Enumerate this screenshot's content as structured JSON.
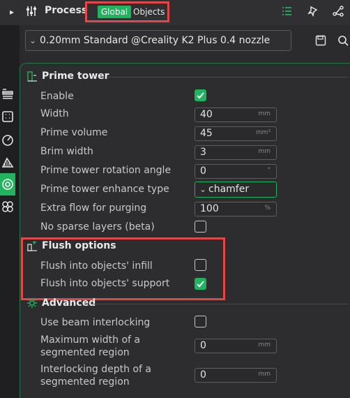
{
  "header": {
    "title": "Process",
    "tab_global": "Global",
    "tab_objects": "Objects",
    "icons": [
      "sliders-icon",
      "global-list-icon",
      "pin-icon",
      "share-icon"
    ]
  },
  "preset": {
    "name": "0.20mm Standard @Creality K2 Plus 0.4 nozzle"
  },
  "prime_tower": {
    "title": "Prime tower",
    "enable_label": "Enable",
    "enable_checked": true,
    "width_label": "Width",
    "width_value": "40",
    "width_unit": "mm",
    "volume_label": "Prime volume",
    "volume_value": "45",
    "volume_unit": "mm³",
    "brim_label": "Brim width",
    "brim_value": "3",
    "brim_unit": "mm",
    "rotation_label": "Prime tower rotation angle",
    "rotation_value": "0",
    "rotation_unit": "°",
    "enhance_label": "Prime tower enhance type",
    "enhance_value": "chamfer",
    "extra_flow_label": "Extra flow for purging",
    "extra_flow_value": "100",
    "extra_flow_unit": "%",
    "sparse_label": "No sparse layers (beta)",
    "sparse_checked": false
  },
  "flush": {
    "title": "Flush options",
    "infill_label": "Flush into objects' infill",
    "infill_checked": false,
    "support_label": "Flush into objects' support",
    "support_checked": true
  },
  "advanced": {
    "title": "Advanced",
    "beam_label": "Use beam interlocking",
    "beam_checked": false,
    "max_width_label_1": "Maximum width of a",
    "max_width_label_2": "segmented region",
    "max_width_value": "0",
    "max_width_unit": "mm",
    "depth_label_1": "Interlocking depth of a",
    "depth_label_2": "segmented region",
    "depth_value": "0",
    "depth_unit": "mm"
  },
  "colors": {
    "accent": "#21b35d",
    "highlight": "#e34747",
    "panel": "#2d2d2f"
  }
}
